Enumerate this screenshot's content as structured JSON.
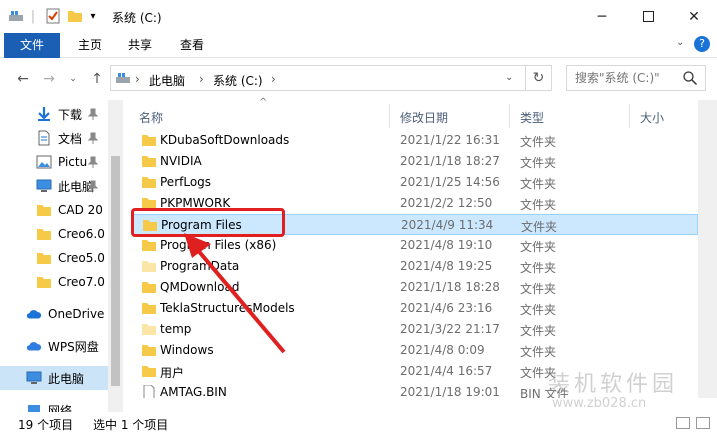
{
  "window": {
    "title": "系统 (C:)"
  },
  "ribbon": {
    "tabs": [
      "文件",
      "主页",
      "共享",
      "查看"
    ]
  },
  "address": {
    "crumbs": [
      "此电脑",
      "系统 (C:)"
    ]
  },
  "search": {
    "placeholder": "搜索\"系统 (C:)\""
  },
  "sidebar": {
    "items": [
      {
        "label": "下载",
        "icon": "download-icon",
        "pinned": true
      },
      {
        "label": "文档",
        "icon": "document-icon",
        "pinned": true
      },
      {
        "label": "Pictu",
        "icon": "pictures-icon",
        "pinned": true
      },
      {
        "label": "此电脑",
        "icon": "computer-icon",
        "pinned": true
      },
      {
        "label": "CAD 20",
        "icon": "folder-icon",
        "pinned": false
      },
      {
        "label": "Creo6.0",
        "icon": "folder-icon",
        "pinned": false
      },
      {
        "label": "Creo5.0",
        "icon": "folder-icon",
        "pinned": false
      },
      {
        "label": "Creo7.0",
        "icon": "folder-icon",
        "pinned": false
      },
      {
        "label": "OneDrive",
        "icon": "cloud-icon",
        "pinned": false
      },
      {
        "label": "WPS网盘",
        "icon": "cloud-icon",
        "pinned": false
      },
      {
        "label": "此电脑",
        "icon": "computer-icon",
        "pinned": false,
        "selected": true
      },
      {
        "label": "网络",
        "icon": "network-icon",
        "pinned": false
      }
    ]
  },
  "columns": {
    "name": "名称",
    "date": "修改日期",
    "type": "类型",
    "size": "大小"
  },
  "files": [
    {
      "name": "KDubaSoftDownloads",
      "date": "2021/1/22 16:31",
      "type": "文件夹"
    },
    {
      "name": "NVIDIA",
      "date": "2021/1/18 18:27",
      "type": "文件夹"
    },
    {
      "name": "PerfLogs",
      "date": "2021/1/25 14:56",
      "type": "文件夹"
    },
    {
      "name": "PKPMWORK",
      "date": "2021/2/2 12:50",
      "type": "文件夹"
    },
    {
      "name": "Program Files",
      "date": "2021/4/9 11:34",
      "type": "文件夹",
      "selected": true
    },
    {
      "name": "Program Files (x86)",
      "date": "2021/4/8 19:10",
      "type": "文件夹"
    },
    {
      "name": "ProgramData",
      "date": "2021/4/8 19:25",
      "type": "文件夹",
      "light": true
    },
    {
      "name": "QMDownload",
      "date": "2021/1/18 18:28",
      "type": "文件夹"
    },
    {
      "name": "TeklaStructuresModels",
      "date": "2021/4/6 23:16",
      "type": "文件夹"
    },
    {
      "name": "temp",
      "date": "2021/3/22 21:17",
      "type": "文件夹",
      "light": true
    },
    {
      "name": "Windows",
      "date": "2021/4/8 0:09",
      "type": "文件夹"
    },
    {
      "name": "用户",
      "date": "2021/4/4 16:57",
      "type": "文件夹"
    },
    {
      "name": "AMTAG.BIN",
      "date": "2021/1/18 19:01",
      "type": "BIN 文件",
      "file": true
    }
  ],
  "status": {
    "count": "19 个项目",
    "selected": "选中 1 个项目"
  },
  "watermark": {
    "line1": "装机软件园",
    "line2": "www.zb028.cn"
  },
  "colors": {
    "accent": "#1a5fb4",
    "selection": "#cce8ff",
    "annotation": "#e02020",
    "folder": "#f7c948"
  }
}
